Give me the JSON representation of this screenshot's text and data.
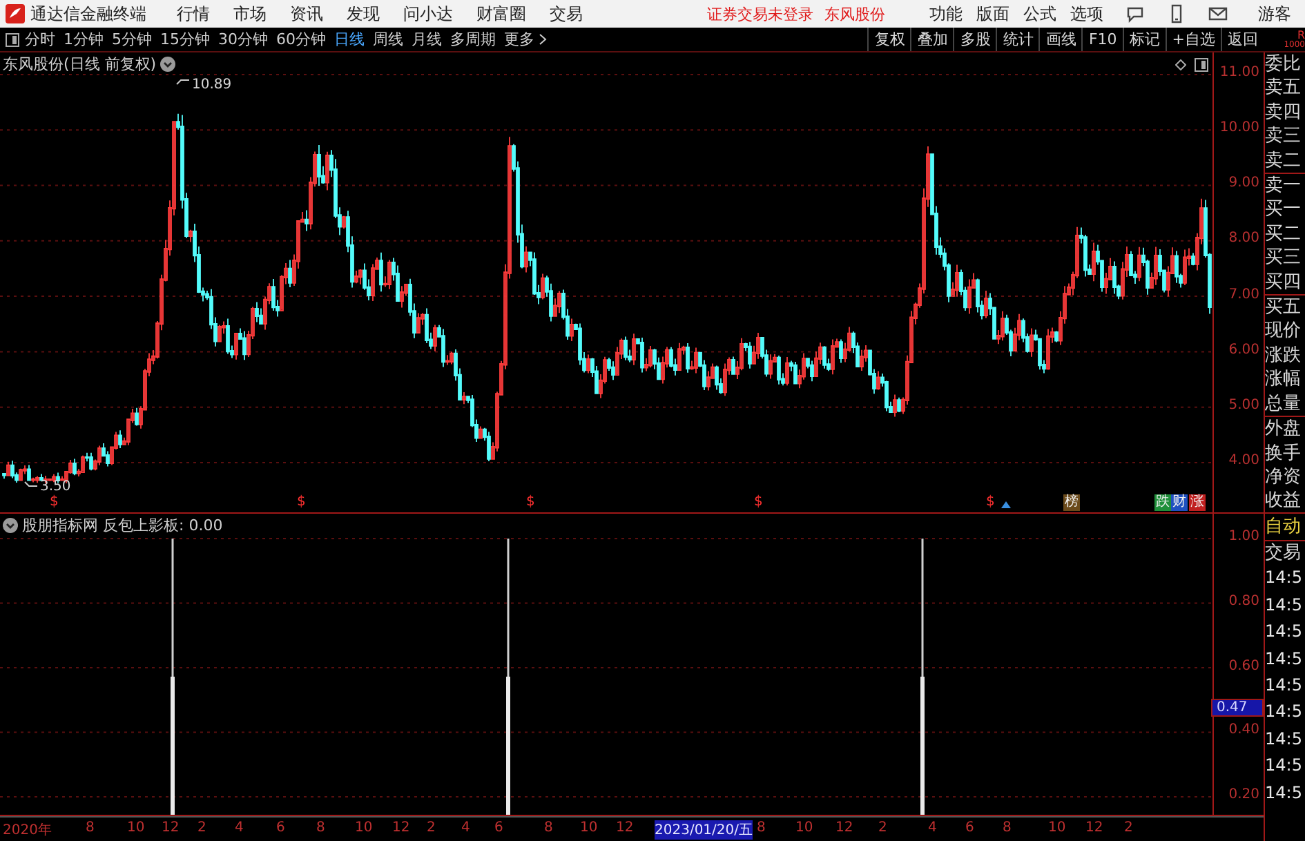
{
  "app": {
    "title": "通达信金融终端",
    "menu": [
      "行情",
      "市场",
      "资讯",
      "发现",
      "问小达",
      "财富圈",
      "交易"
    ],
    "notice": "证券交易未登录",
    "stock_link": "东风股份",
    "right_menu": [
      "功能",
      "版面",
      "公式",
      "选项"
    ],
    "user": "游客"
  },
  "periods": [
    {
      "label": "分时",
      "selected": false
    },
    {
      "label": "1分钟",
      "selected": false
    },
    {
      "label": "5分钟",
      "selected": false
    },
    {
      "label": "15分钟",
      "selected": false
    },
    {
      "label": "30分钟",
      "selected": false
    },
    {
      "label": "60分钟",
      "selected": false
    },
    {
      "label": "日线",
      "selected": true
    },
    {
      "label": "周线",
      "selected": false
    },
    {
      "label": "月线",
      "selected": false
    },
    {
      "label": "多周期",
      "selected": false
    },
    {
      "label": "更多",
      "selected": false
    }
  ],
  "tools": [
    "复权",
    "叠加",
    "多股",
    "统计",
    "画线",
    "F10",
    "标记",
    "+自选",
    "返回"
  ],
  "corner": [
    "R",
    "1000"
  ],
  "price_chart": {
    "title": "东风股份(日线 前复权)",
    "high_label": "10.89",
    "low_label": "3.50",
    "y_ticks": [
      "11.00",
      "10.00",
      "9.00",
      "8.00",
      "7.00",
      "6.00",
      "5.00",
      "4.00"
    ],
    "signals": [
      {
        "text": "$",
        "kind": "mark"
      },
      {
        "text": "$",
        "kind": "mark"
      },
      {
        "text": "$",
        "kind": "mark"
      },
      {
        "text": "$",
        "kind": "mark"
      },
      {
        "text": "$",
        "kind": "mark"
      },
      {
        "text": "榜",
        "kind": "badge",
        "color": "#6b4a1a"
      },
      {
        "text": "跌",
        "kind": "badge",
        "color": "#1f8f3a"
      },
      {
        "text": "财",
        "kind": "badge",
        "color": "#2050c0"
      },
      {
        "text": "涨",
        "kind": "badge",
        "color": "#c02020"
      }
    ]
  },
  "indicator": {
    "title": "股朋指标网 反包上影板: 0.00",
    "y_ticks": [
      "1.00",
      "0.80",
      "0.60",
      "0.40",
      "0.20"
    ],
    "cursor_value": "0.47"
  },
  "side_panel": {
    "quote_labels": [
      "委比",
      "卖五",
      "卖四",
      "卖三",
      "卖二",
      "卖一",
      "买一",
      "买二",
      "买三",
      "买四",
      "买五",
      "现价",
      "涨跌",
      "涨幅",
      "总量",
      "外盘",
      "换手",
      "净资",
      "收益"
    ],
    "mode": "自动",
    "trade_label": "交易",
    "times": [
      "14:5",
      "14:5",
      "14:5",
      "14:5",
      "14:5",
      "14:5",
      "14:5",
      "14:5",
      "14:5"
    ]
  },
  "x_axis": {
    "labels": [
      "2020年",
      "8",
      "10",
      "12",
      "2",
      "4",
      "6",
      "8",
      "10",
      "12",
      "2",
      "4",
      "6",
      "8",
      "10",
      "12",
      "2023/01/20/五",
      "8",
      "10",
      "12",
      "2",
      "4",
      "6",
      "8",
      "10",
      "12",
      "2"
    ]
  }
}
